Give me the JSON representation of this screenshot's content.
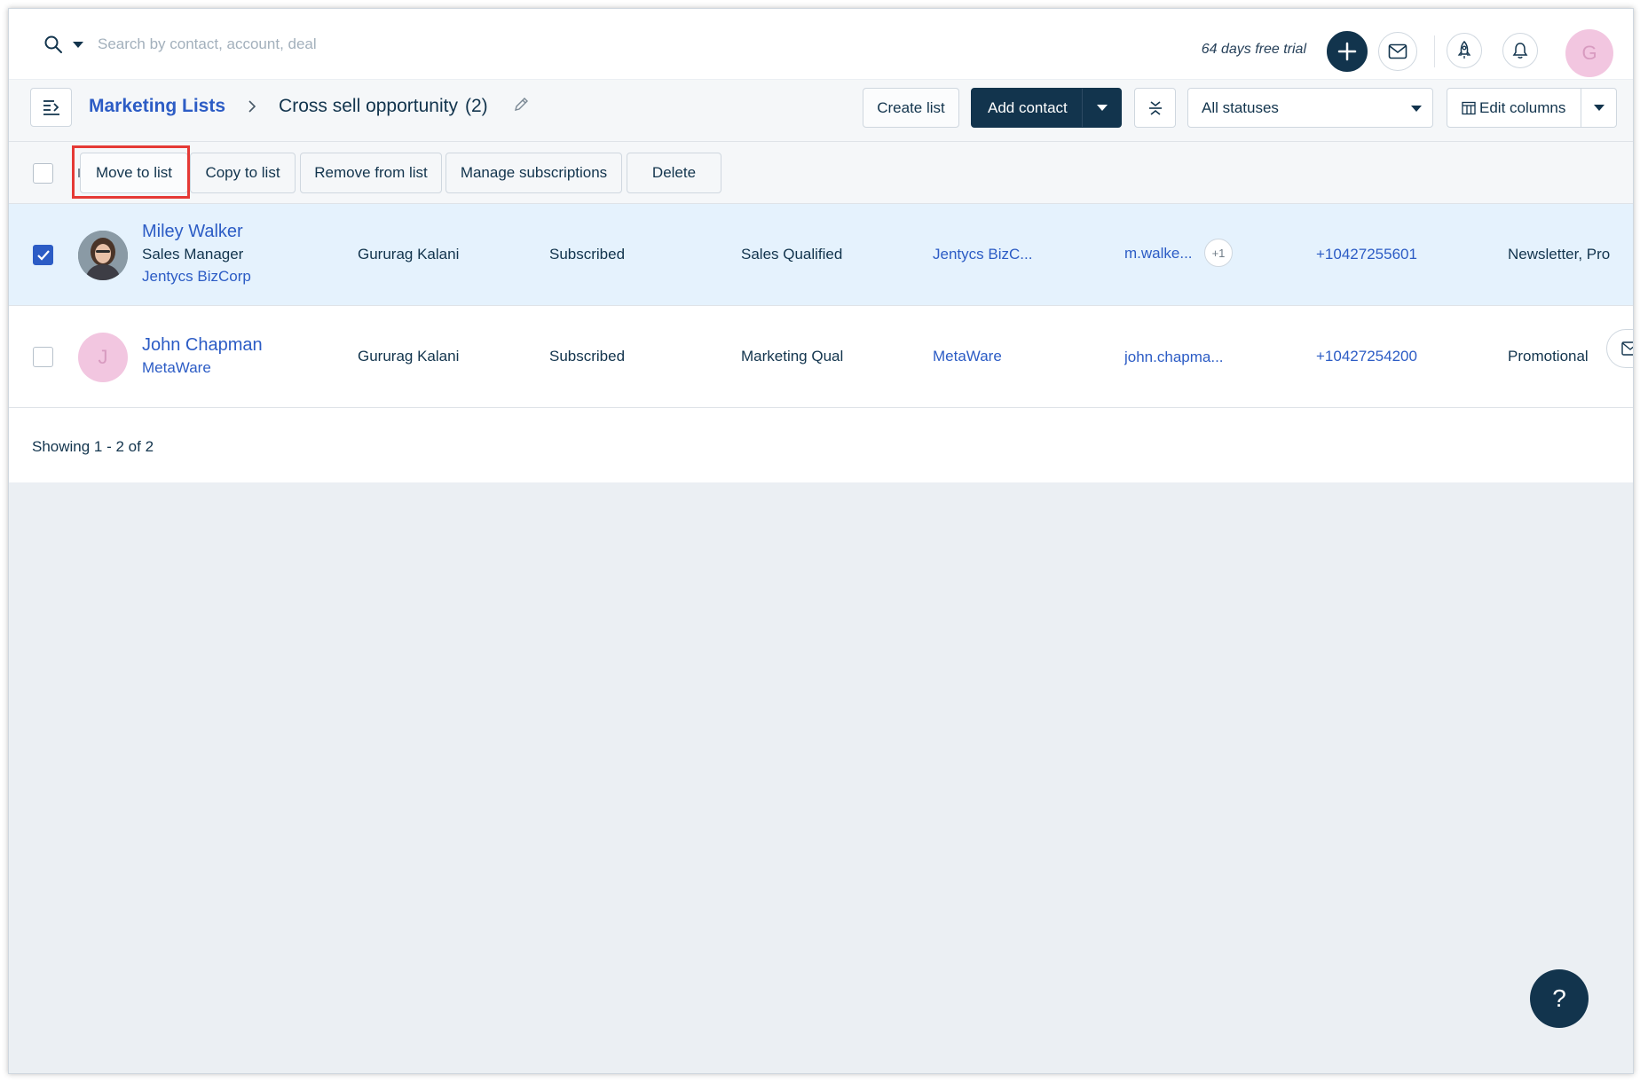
{
  "topbar": {
    "search_placeholder": "Search by contact, account, deal",
    "trial_text": "64 days free trial",
    "avatar_initial": "G"
  },
  "header": {
    "breadcrumb_root": "Marketing Lists",
    "current_list": "Cross sell opportunity",
    "current_count": "(2)",
    "create_list_label": "Create list",
    "add_contact_label": "Add contact",
    "status_filter_value": "All statuses",
    "edit_columns_label": "Edit columns"
  },
  "bulk_actions": {
    "move_to_list": "Move to list",
    "copy_to_list": "Copy to list",
    "remove_from_list": "Remove from list",
    "manage_subscriptions": "Manage subscriptions",
    "delete": "Delete"
  },
  "rows": [
    {
      "selected": true,
      "name": "Miley Walker",
      "job_title": "Sales Manager",
      "company": "Jentycs BizCorp",
      "owner": "Gururag Kalani",
      "subscription_status": "Subscribed",
      "lifecycle_stage": "Sales Qualified",
      "account": "Jentycs BizC...",
      "email": "m.walke...",
      "email_extra": "+1",
      "phone": "+10427255601",
      "lists": "Newsletter, Pro"
    },
    {
      "selected": false,
      "avatar_initial": "J",
      "name": "John Chapman",
      "company": "MetaWare",
      "owner": "Gururag Kalani",
      "subscription_status": "Subscribed",
      "lifecycle_stage": "Marketing Qual",
      "account": "MetaWare",
      "email": "john.chapma...",
      "phone": "+10427254200",
      "lists": "Promotional"
    }
  ],
  "footer": {
    "showing_text": "Showing 1 - 2 of 2"
  },
  "help": {
    "label": "?"
  },
  "colors": {
    "primary_dark": "#12344d",
    "link_blue": "#2c5cc5",
    "selected_row": "#e5f2fd",
    "highlight_red": "#e53935"
  }
}
